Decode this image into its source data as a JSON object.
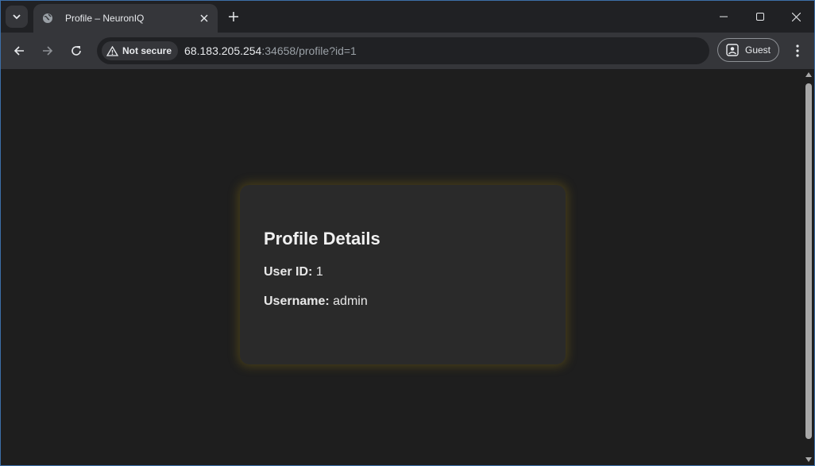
{
  "browser": {
    "tab_title": "Profile – NeuronIQ",
    "security_chip": "Not secure",
    "url_host": "68.183.205.254",
    "url_rest": ":34658/profile?id=1",
    "profile_label": "Guest"
  },
  "icons": [
    "tab-search-icon",
    "globe-icon",
    "close-icon",
    "plus-icon",
    "minimize-icon",
    "maximize-icon",
    "window-close-icon",
    "back-icon",
    "forward-icon",
    "reload-icon",
    "warning-icon",
    "guest-icon",
    "more-icon"
  ],
  "colors": {
    "page_bg": "#1e1e1e",
    "card_bg": "#2a2a2a",
    "card_glow": "#786414"
  },
  "card": {
    "title": "Profile Details",
    "user_id_label": "User ID:",
    "user_id_value": "1",
    "username_label": "Username:",
    "username_value": "admin"
  }
}
